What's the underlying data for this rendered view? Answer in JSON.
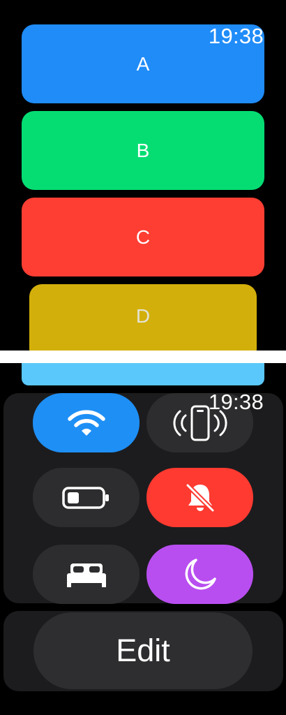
{
  "top_screen": {
    "time": "19:38",
    "cards": [
      {
        "label": "A",
        "color": "#1f8cf8"
      },
      {
        "label": "B",
        "color": "#05dd73"
      },
      {
        "label": "C",
        "color": "#fe3e33"
      },
      {
        "label": "D",
        "color": "#d3af0b"
      },
      {
        "label": "",
        "color": "#5ac8fa"
      }
    ]
  },
  "control_center": {
    "time": "19:38",
    "tiles": [
      {
        "icon": "wifi-icon",
        "color": "#1e8ff5",
        "active": true
      },
      {
        "icon": "ping-phone-icon",
        "color": "#2d2d2f",
        "active": false
      },
      {
        "icon": "battery-icon",
        "color": "#2d2d2f",
        "active": false
      },
      {
        "icon": "silent-mode-icon",
        "color": "#fe3a31",
        "active": true
      },
      {
        "icon": "sleep-bed-icon",
        "color": "#2d2d2f",
        "active": false
      },
      {
        "icon": "do-not-disturb-moon-icon",
        "color": "#b84ef0",
        "active": true
      }
    ],
    "edit_label": "Edit"
  }
}
